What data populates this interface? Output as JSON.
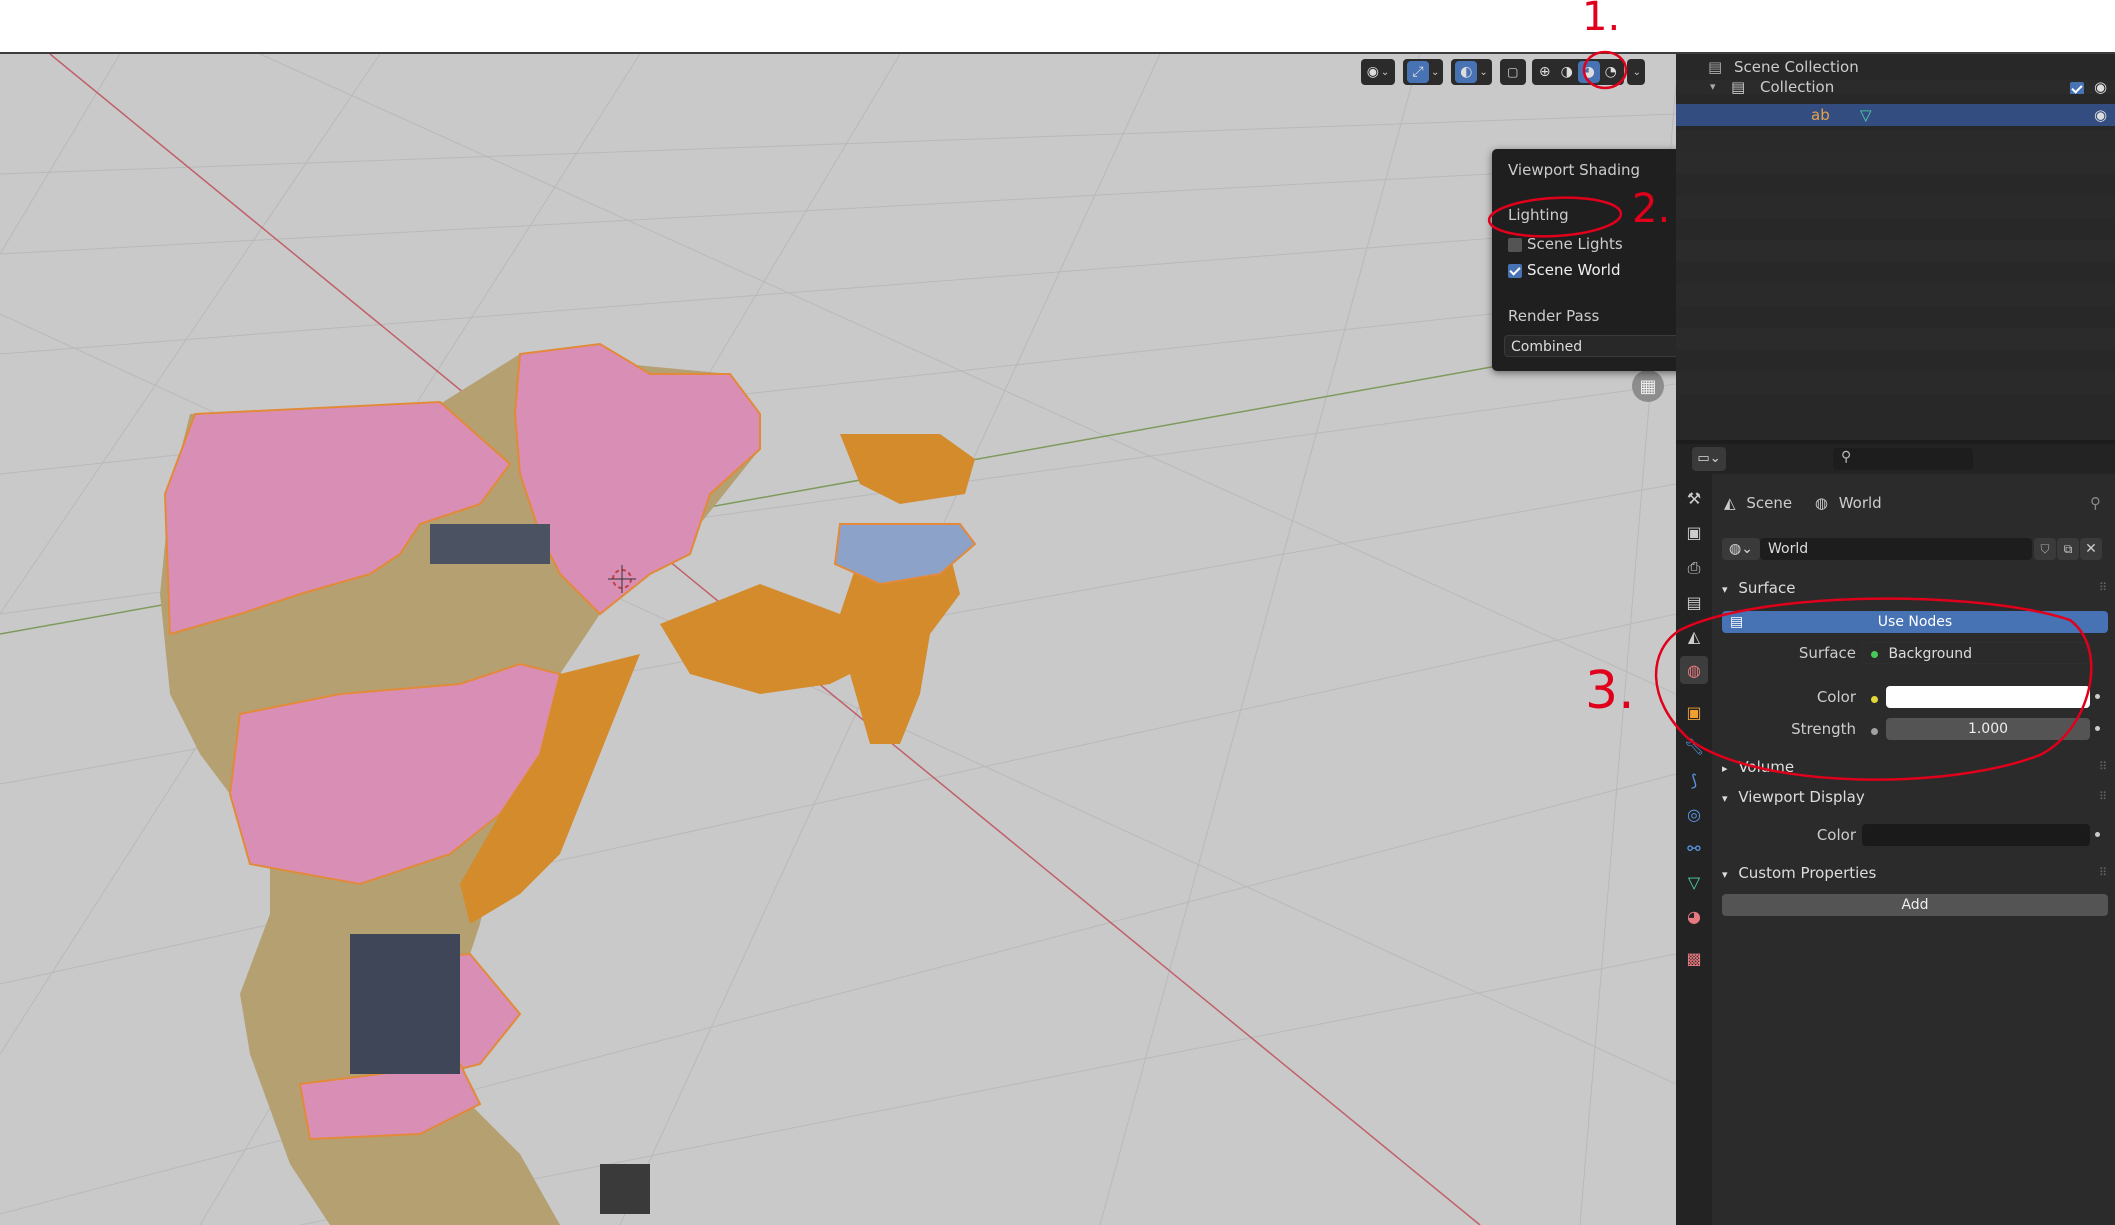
{
  "annotations": {
    "n1": "1.",
    "n2": "2.",
    "n3": "3."
  },
  "viewport_popup": {
    "title": "Viewport Shading",
    "lighting_label": "Lighting",
    "scene_lights_label": "Scene Lights",
    "scene_lights_checked": false,
    "scene_world_label": "Scene World",
    "scene_world_checked": true,
    "render_pass_label": "Render Pass",
    "render_pass_value": "Combined"
  },
  "outliner": {
    "scene_collection": "Scene Collection",
    "collection": "Collection",
    "object_suffix": "ab"
  },
  "properties": {
    "breadcrumb_scene": "Scene",
    "breadcrumb_world": "World",
    "world_name": "World",
    "surface_section": "Surface",
    "use_nodes_label": "Use Nodes",
    "surface_label": "Surface",
    "surface_value": "Background",
    "color_label": "Color",
    "color_value": "#ffffff",
    "strength_label": "Strength",
    "strength_value": "1.000",
    "volume_section": "Volume",
    "viewport_display_section": "Viewport Display",
    "vd_color_label": "Color",
    "vd_color_value": "#1a1a1a",
    "custom_props_section": "Custom Properties",
    "add_label": "Add"
  },
  "colors": {
    "accent_blue": "#4772b3",
    "selection_blue": "#334d80",
    "annotation_red": "#e0001b",
    "viewport_bg": "#c9c9c9"
  },
  "icons": [
    "eye-icon",
    "gizmo-icon",
    "overlay-icon",
    "xray-icon",
    "wireframe-icon",
    "solid-icon",
    "material-preview-icon",
    "rendered-icon",
    "world-icon",
    "scene-icon",
    "pin-icon",
    "search-icon",
    "tool-icon",
    "render-icon",
    "output-icon",
    "view-layer-icon",
    "scene-tab-icon",
    "world-tab-icon",
    "object-icon",
    "modifier-icon",
    "particles-icon",
    "physics-icon",
    "constraints-icon",
    "data-icon",
    "material-icon",
    "texture-icon",
    "grid-icon"
  ]
}
